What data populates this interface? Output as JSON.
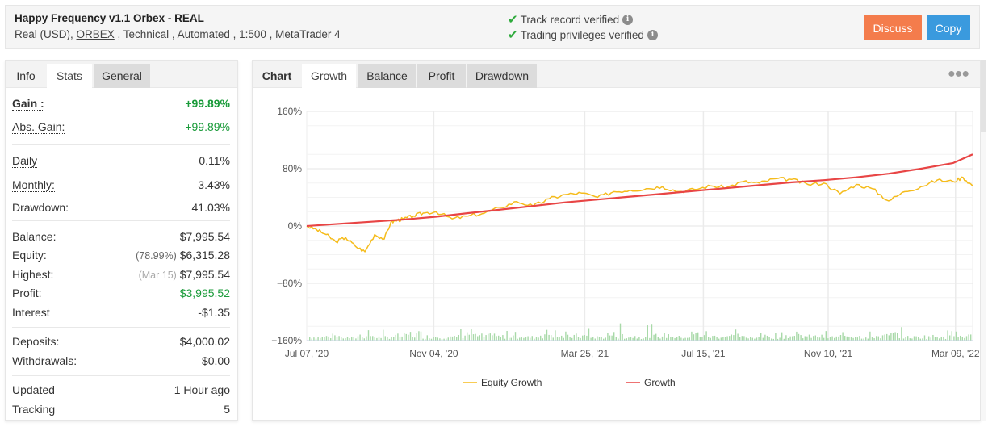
{
  "header": {
    "title": "Happy Frequency v1.1 Orbex - REAL",
    "subtitle_prefix": "Real (USD), ",
    "broker_link": "ORBEX",
    "subtitle_suffix": " , Technical , Automated , 1:500 , MetaTrader 4",
    "verifications": [
      {
        "icon": "check-icon",
        "label": "Track record verified",
        "info_icon": "info-icon"
      },
      {
        "icon": "check-icon",
        "label": "Trading privileges verified",
        "info_icon": "info-icon"
      }
    ],
    "buttons": {
      "discuss": "Discuss",
      "copy": "Copy"
    },
    "colors": {
      "discuss": "#f47c4c",
      "copy": "#3a9ade",
      "verified": "#2eaa3c"
    }
  },
  "stats_panel": {
    "tabs": [
      {
        "label": "Info",
        "state": "normal"
      },
      {
        "label": "Stats",
        "state": "active"
      },
      {
        "label": "General",
        "state": "inactive"
      }
    ],
    "groups": [
      [
        {
          "label": "Gain :",
          "value": "+99.89%",
          "style": "green-bold"
        },
        {
          "label": "Abs. Gain:",
          "value": "+99.89%",
          "style": "green"
        }
      ],
      [
        {
          "label": "Daily",
          "value": "0.11%"
        },
        {
          "label": "Monthly:",
          "value": "3.43%"
        },
        {
          "label": "Drawdown:",
          "value": "41.03%"
        }
      ],
      [
        {
          "label": "Balance:",
          "value": "$7,995.54"
        },
        {
          "label": "Equity:",
          "note": "(78.99%)",
          "value": "$6,315.28"
        },
        {
          "label": "Highest:",
          "note": "(Mar 15)",
          "value": "$7,995.54"
        },
        {
          "label": "Profit:",
          "value": "$3,995.52",
          "style": "green"
        },
        {
          "label": "Interest",
          "value": "-$1.35"
        }
      ],
      [
        {
          "label": "Deposits:",
          "value": "$4,000.02"
        },
        {
          "label": "Withdrawals:",
          "value": "$0.00"
        }
      ],
      [
        {
          "label": "Updated",
          "value": "1 Hour ago"
        },
        {
          "label": "Tracking",
          "value": "5"
        }
      ]
    ]
  },
  "chart_panel": {
    "tabs": [
      {
        "label": "Chart",
        "state": "normal"
      },
      {
        "label": "Growth",
        "state": "active"
      },
      {
        "label": "Balance",
        "state": "inactive"
      },
      {
        "label": "Profit",
        "state": "inactive"
      },
      {
        "label": "Drawdown",
        "state": "inactive"
      }
    ],
    "menu_icon": "more-horizontal-icon"
  },
  "chart_data": {
    "type": "line",
    "title": "",
    "xlabel": "",
    "ylabel": "",
    "ylim": [
      -160,
      160
    ],
    "yticks": [
      160,
      80,
      0,
      -80,
      -160
    ],
    "ytick_labels": [
      "160%",
      "80%",
      "0%",
      "−80%",
      "−160%"
    ],
    "x_tick_labels": [
      "Jul 07, '20",
      "Nov 04, '20",
      "Mar 25, '21",
      "Jul 15, '21",
      "Nov 10, '21",
      "Mar 09, '22"
    ],
    "x_range_months": [
      0,
      20.6
    ],
    "x_tick_months": [
      0,
      3.93,
      8.6,
      12.27,
      16.13,
      20.07
    ],
    "grid": true,
    "legend": {
      "placement": "bottom-center",
      "entries": [
        {
          "name": "Equity Growth",
          "color": "#f5bc1c"
        },
        {
          "name": "Growth",
          "color": "#e84545"
        }
      ]
    },
    "series": [
      {
        "name": "Growth",
        "color": "#e84545",
        "x": [
          0,
          1,
          2,
          3,
          4,
          5,
          6,
          7,
          8,
          9,
          10,
          11,
          12,
          13,
          14,
          15,
          16,
          17,
          18,
          19,
          20,
          20.6
        ],
        "y": [
          0,
          3,
          6,
          9,
          13,
          18,
          23,
          28,
          33,
          37,
          41,
          45,
          49,
          53,
          57,
          61,
          64,
          68,
          73,
          80,
          88,
          100
        ]
      },
      {
        "name": "Equity Growth",
        "color": "#f5bc1c",
        "x": [
          0,
          0.3,
          0.6,
          0.9,
          1.2,
          1.5,
          1.8,
          2.1,
          2.4,
          2.6,
          2.8,
          3.0,
          3.3,
          3.6,
          4.0,
          4.5,
          5.0,
          5.5,
          6.0,
          6.5,
          7.0,
          7.5,
          8.0,
          8.5,
          9.0,
          9.5,
          10.0,
          10.5,
          11.0,
          11.5,
          12.0,
          12.5,
          13.0,
          13.5,
          14.0,
          14.5,
          15.0,
          15.5,
          16.0,
          16.5,
          17.0,
          17.5,
          18.0,
          18.5,
          19.0,
          19.5,
          20.0,
          20.3,
          20.6
        ],
        "y": [
          0,
          -5,
          -12,
          -22,
          -16,
          -28,
          -36,
          -12,
          -18,
          5,
          8,
          10,
          14,
          18,
          20,
          10,
          14,
          18,
          26,
          34,
          28,
          38,
          44,
          46,
          40,
          48,
          50,
          52,
          55,
          48,
          51,
          56,
          54,
          62,
          60,
          66,
          65,
          58,
          60,
          45,
          58,
          52,
          35,
          48,
          55,
          64,
          62,
          68,
          56
        ]
      }
    ],
    "bars": {
      "name": "Daily activity",
      "color": "#a8d9a8",
      "note": "small green histogram along the bottom axis",
      "values_relative": [
        0.3,
        0.4,
        0.2,
        0.6,
        0.3,
        0.5,
        0.8,
        0.4,
        0.3,
        1.0,
        0.5,
        0.4,
        0.6,
        0.3,
        0.9,
        0.4,
        0.5,
        0.3,
        0.7,
        0.4,
        0.5,
        0.6,
        0.3,
        0.8,
        0.4,
        0.5,
        0.3,
        0.4,
        0.6,
        0.5,
        0.4,
        0.3,
        0.6,
        0.4,
        0.5,
        0.7,
        0.3,
        0.4,
        0.8,
        0.5
      ]
    }
  }
}
